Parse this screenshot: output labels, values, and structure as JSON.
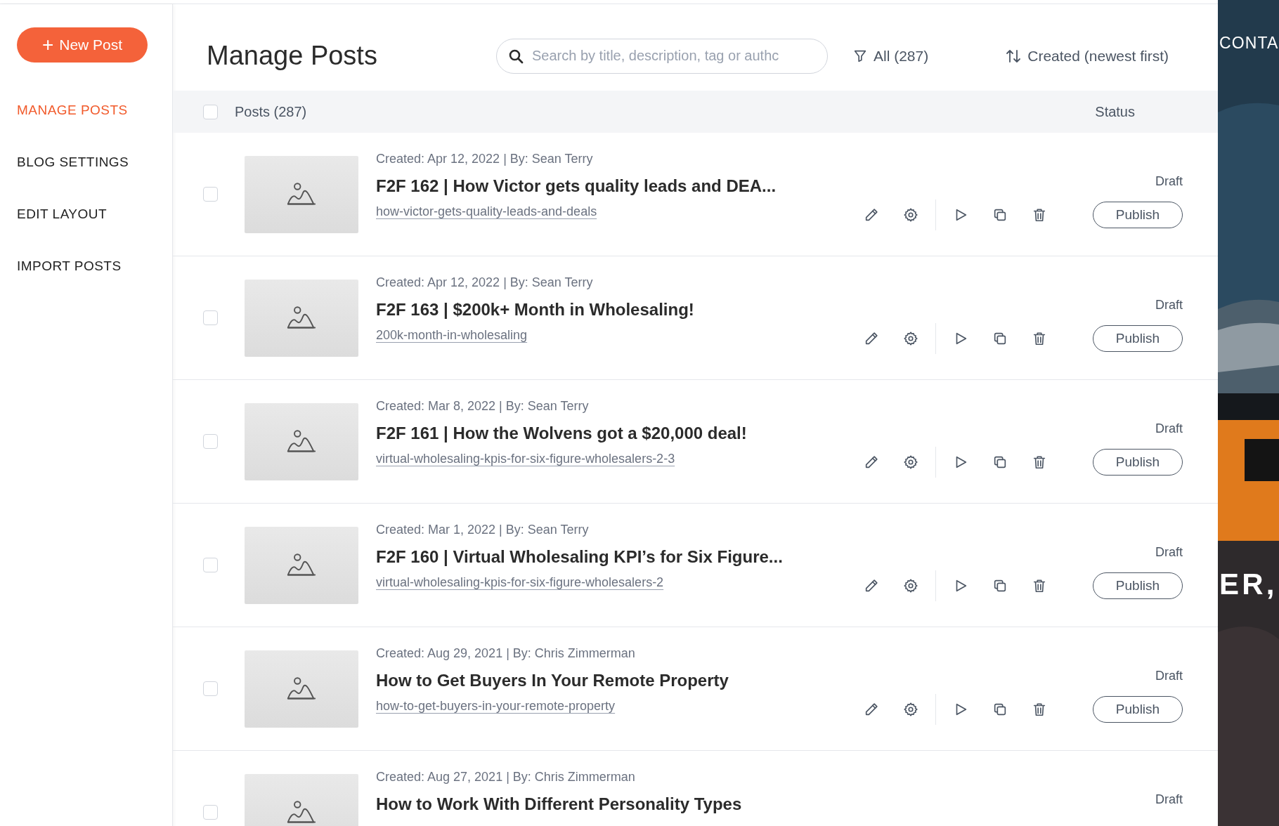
{
  "sidebar": {
    "new_post_button": {
      "icon": "+",
      "label": "New Post"
    },
    "items": [
      {
        "label": "MANAGE POSTS",
        "selected": true
      },
      {
        "label": "BLOG SETTINGS",
        "selected": false
      },
      {
        "label": "EDIT LAYOUT",
        "selected": false
      },
      {
        "label": "IMPORT POSTS",
        "selected": false
      }
    ]
  },
  "header": {
    "title": "Manage Posts",
    "search": {
      "placeholder": "Search by title, description, tag or authc"
    },
    "filter": "All (287)",
    "sort": "Created (newest first)"
  },
  "table": {
    "columns": [
      "Posts (287)",
      "Status"
    ],
    "all_checked": false,
    "rows": [
      {
        "checked": false,
        "meta": "Created: Apr 12, 2022 | By: Sean Terry",
        "title": "F2F 162 | How Victor gets quality leads and DEA...",
        "slug": "how-victor-gets-quality-leads-and-deals",
        "status": "Draft",
        "action": "Publish"
      },
      {
        "checked": false,
        "meta": "Created: Apr 12, 2022 | By: Sean Terry",
        "title": "F2F 163 | $200k+ Month in Wholesaling!",
        "slug": "200k-month-in-wholesaling",
        "status": "Draft",
        "action": "Publish"
      },
      {
        "checked": false,
        "meta": "Created: Mar 8, 2022 | By: Sean Terry",
        "title": "F2F 161 | How the Wolvens got a $20,000 deal!",
        "slug": "virtual-wholesaling-kpis-for-six-figure-wholesalers-2-3",
        "status": "Draft",
        "action": "Publish"
      },
      {
        "checked": false,
        "meta": "Created: Mar 1, 2022 | By: Sean Terry",
        "title": "F2F 160 | Virtual Wholesaling KPI’s for Six Figure...",
        "slug": "virtual-wholesaling-kpis-for-six-figure-wholesalers-2",
        "status": "Draft",
        "action": "Publish"
      },
      {
        "checked": false,
        "meta": "Created: Aug 29, 2021 | By: Chris Zimmerman",
        "title": "How to Get Buyers In Your Remote Property",
        "slug": "how-to-get-buyers-in-your-remote-property",
        "status": "Draft",
        "action": "Publish"
      },
      {
        "checked": false,
        "meta": "Created: Aug 27, 2021 | By: Chris Zimmerman",
        "title": "How to Work With Different Personality Types",
        "status": "Draft"
      }
    ]
  },
  "background_site": {
    "nav_text": "CONTA",
    "heading_text": "ER,"
  }
}
